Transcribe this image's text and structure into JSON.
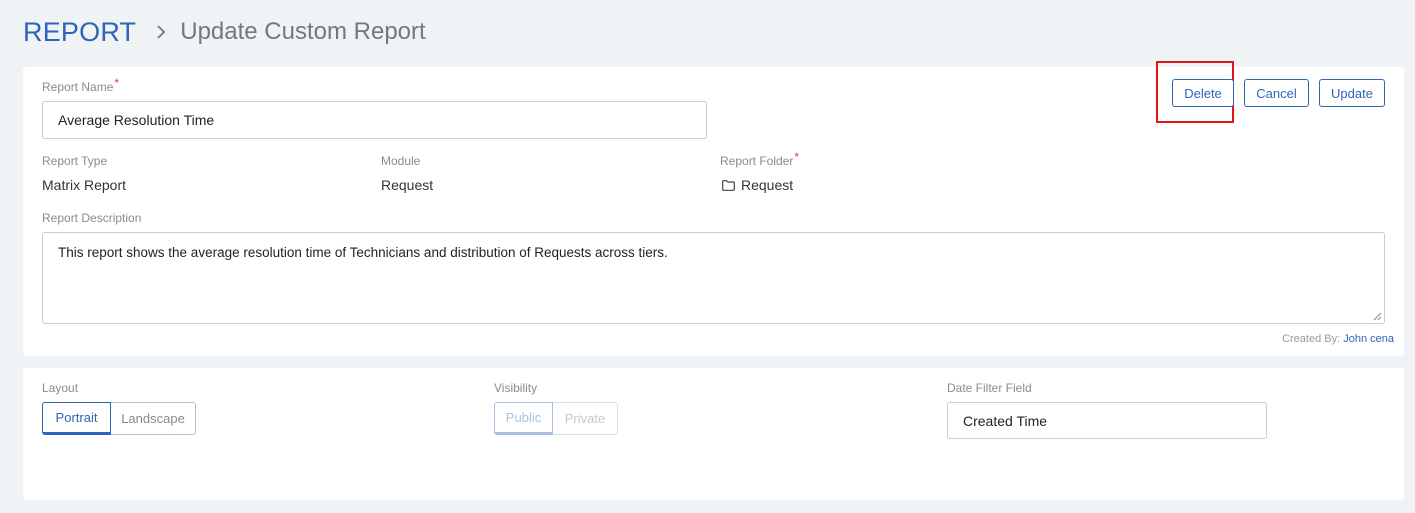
{
  "breadcrumb": {
    "root": "REPORT",
    "page": "Update Custom Report"
  },
  "form": {
    "report_name": {
      "label": "Report Name",
      "required_mark": "*",
      "value": "Average Resolution Time"
    },
    "report_type": {
      "label": "Report Type",
      "value": "Matrix Report"
    },
    "module": {
      "label": "Module",
      "value": "Request"
    },
    "report_folder": {
      "label": "Report Folder",
      "required_mark": "*",
      "value": "Request",
      "icon": "folder-icon"
    },
    "report_description": {
      "label": "Report Description",
      "value": "This report shows the average resolution time of Technicians and distribution of Requests across tiers."
    },
    "created_by": {
      "prefix": "Created By:",
      "user": "John cena"
    }
  },
  "actions": {
    "delete": "Delete",
    "cancel": "Cancel",
    "update": "Update",
    "highlight_color": "#e01616"
  },
  "settings": {
    "layout": {
      "label": "Layout",
      "options": [
        "Portrait",
        "Landscape"
      ],
      "selected": "Portrait"
    },
    "visibility": {
      "label": "Visibility",
      "options": [
        "Public",
        "Private"
      ],
      "selected": "Public"
    },
    "date_filter": {
      "label": "Date Filter Field",
      "value": "Created Time"
    }
  },
  "colors": {
    "accent": "#2e65b8",
    "required": "#e23b3b",
    "background": "#f0f3f6"
  }
}
